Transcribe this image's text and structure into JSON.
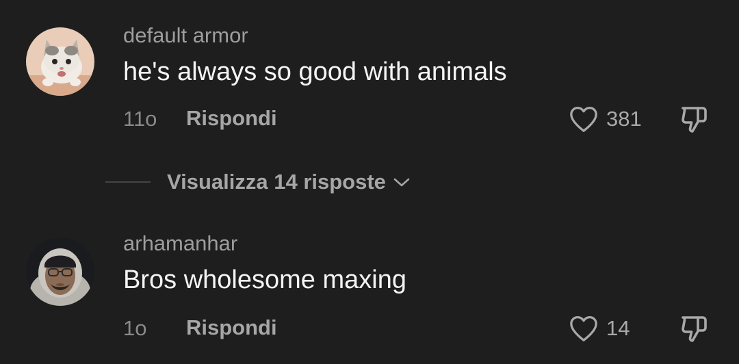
{
  "colors": {
    "background": "#1e1e1e",
    "username": "#9d9d9d",
    "text": "#f4f4f4",
    "muted": "#a6a6a6"
  },
  "comments": [
    {
      "avatar_icon": "kitten-avatar",
      "username": "default armor",
      "text": "he's always so good with animals",
      "time": "11o",
      "reply_label": "Rispondi",
      "like_icon": "heart-outline-icon",
      "likes": "381",
      "dislike_icon": "thumbs-down-icon"
    },
    {
      "avatar_icon": "person-avatar",
      "username": "arhamanhar",
      "text": "Bros wholesome maxing",
      "time": "1o",
      "reply_label": "Rispondi",
      "like_icon": "heart-outline-icon",
      "likes": "14",
      "dislike_icon": "thumbs-down-icon"
    }
  ],
  "view_replies": {
    "label": "Visualizza 14 risposte",
    "icon": "chevron-down-icon"
  }
}
